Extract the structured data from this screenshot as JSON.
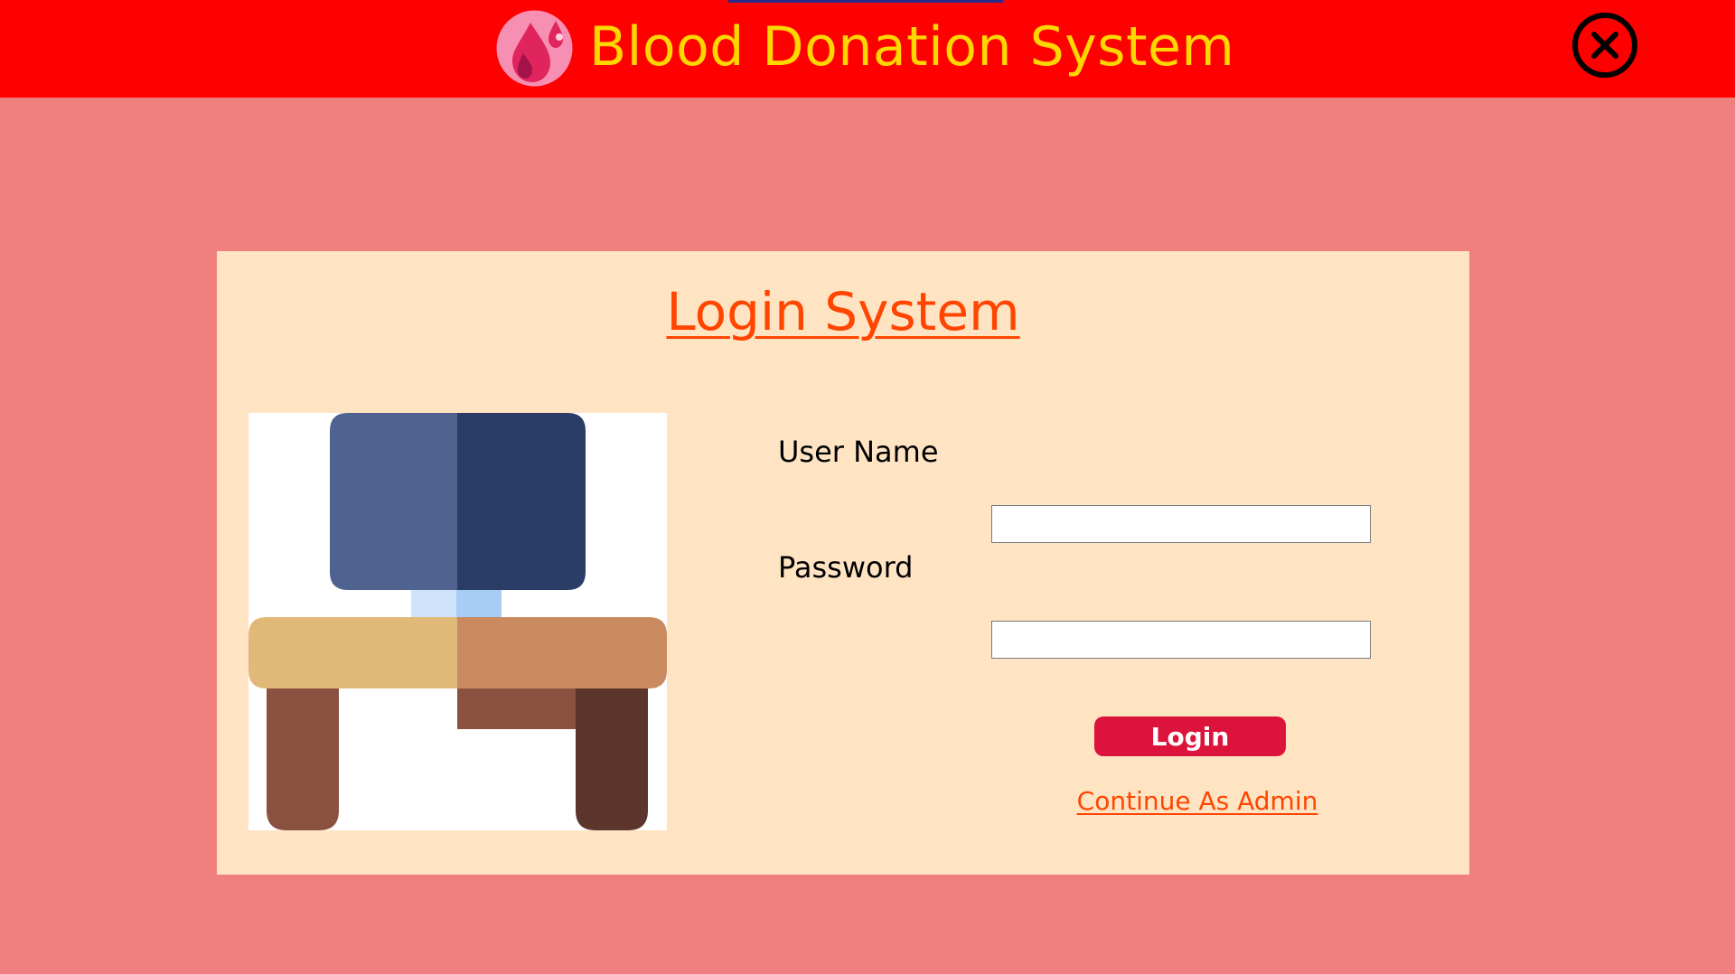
{
  "header": {
    "title": "Blood Donation System",
    "logo_icon": "blood-drop-icon",
    "close_icon": "close-icon",
    "background_color": "#ff0000",
    "title_color": "#ffd700"
  },
  "login": {
    "title": "Login System",
    "username_label": "User Name",
    "username_value": "",
    "password_label": "Password",
    "password_value": "",
    "login_button": "Login",
    "admin_link": "Continue As Admin",
    "illustration_icon": "computer-desk-icon"
  },
  "colors": {
    "page_background": "#f08080",
    "card_background": "#ffe4c4",
    "accent": "#ff4500",
    "button": "#dc143c"
  }
}
